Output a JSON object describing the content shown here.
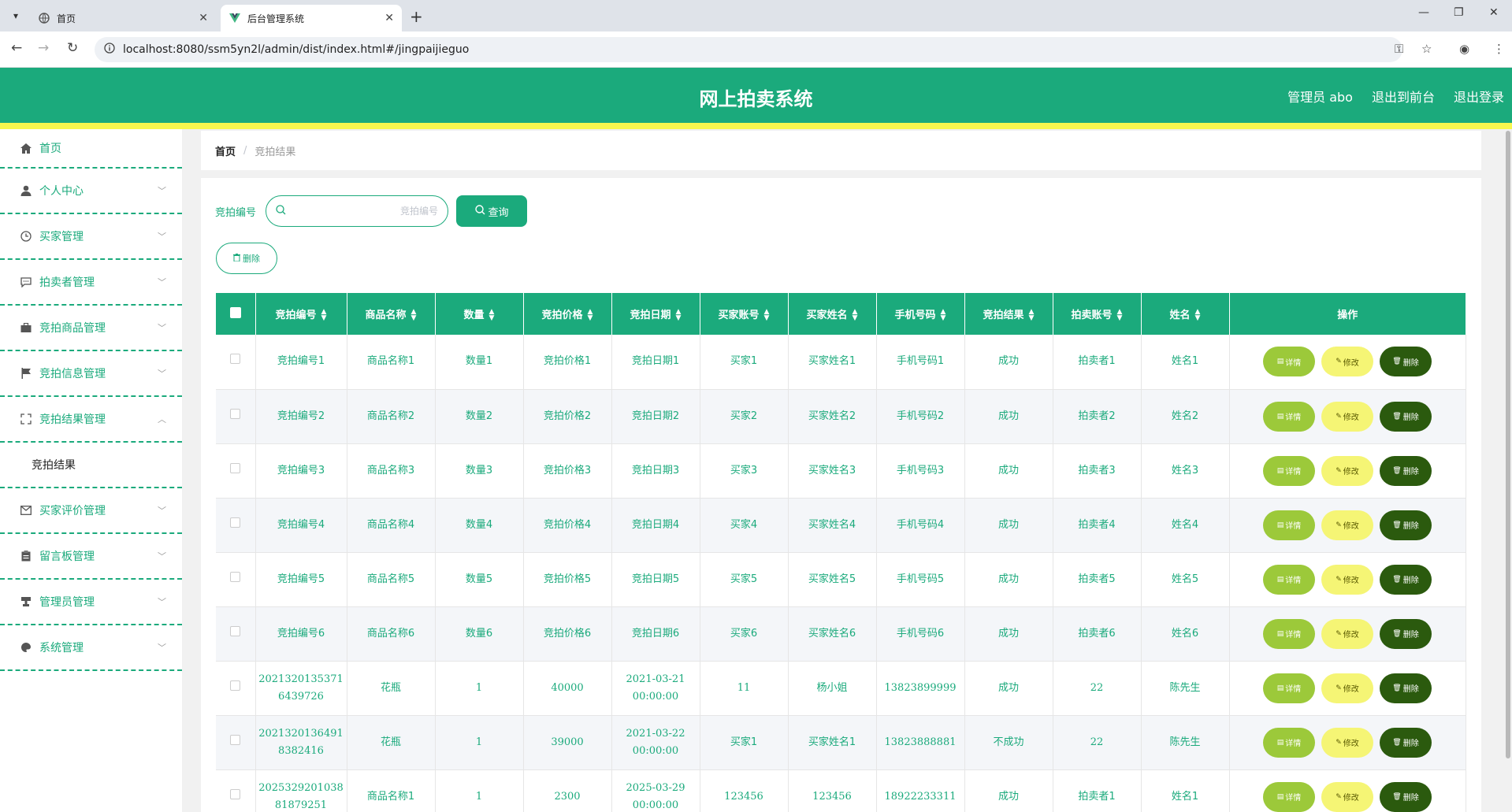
{
  "browser": {
    "tabs": [
      {
        "title": "首页"
      },
      {
        "title": "后台管理系统"
      }
    ],
    "url": "localhost:8080/ssm5yn2l/admin/dist/index.html#/jingpaijieguo"
  },
  "header": {
    "title": "网上拍卖系统",
    "admin": "管理员 abo",
    "to_front": "退出到前台",
    "logout": "退出登录"
  },
  "sidebar": {
    "items": [
      {
        "label": "首页",
        "icon": "home-icon"
      },
      {
        "label": "个人中心",
        "icon": "user-icon"
      },
      {
        "label": "买家管理",
        "icon": "clock-icon"
      },
      {
        "label": "拍卖者管理",
        "icon": "chat-icon"
      },
      {
        "label": "竞拍商品管理",
        "icon": "briefcase-icon"
      },
      {
        "label": "竞拍信息管理",
        "icon": "flag-icon"
      },
      {
        "label": "竞拍结果管理",
        "icon": "fullscreen-icon"
      },
      {
        "label": "竞拍结果",
        "icon": ""
      },
      {
        "label": "买家评价管理",
        "icon": "mail-icon"
      },
      {
        "label": "留言板管理",
        "icon": "clipboard-icon"
      },
      {
        "label": "管理员管理",
        "icon": "stamp-icon"
      },
      {
        "label": "系统管理",
        "icon": "palette-icon"
      }
    ]
  },
  "breadcrumb": {
    "home": "首页",
    "sep": "/",
    "current": "竞拍结果"
  },
  "search": {
    "label": "竞拍编号",
    "placeholder": "竞拍编号",
    "query_btn": "查询",
    "bulk_delete": "删除"
  },
  "table": {
    "columns": [
      "竞拍编号",
      "商品名称",
      "数量",
      "竞拍价格",
      "竞拍日期",
      "买家账号",
      "买家姓名",
      "手机号码",
      "竞拍结果",
      "拍卖账号",
      "姓名",
      "操作"
    ],
    "actions": {
      "detail": "详情",
      "edit": "修改",
      "delete": "删除"
    },
    "rows": [
      [
        "竞拍编号1",
        "商品名称1",
        "数量1",
        "竞拍价格1",
        "竞拍日期1",
        "买家1",
        "买家姓名1",
        "手机号码1",
        "成功",
        "拍卖者1",
        "姓名1"
      ],
      [
        "竞拍编号2",
        "商品名称2",
        "数量2",
        "竞拍价格2",
        "竞拍日期2",
        "买家2",
        "买家姓名2",
        "手机号码2",
        "成功",
        "拍卖者2",
        "姓名2"
      ],
      [
        "竞拍编号3",
        "商品名称3",
        "数量3",
        "竞拍价格3",
        "竞拍日期3",
        "买家3",
        "买家姓名3",
        "手机号码3",
        "成功",
        "拍卖者3",
        "姓名3"
      ],
      [
        "竞拍编号4",
        "商品名称4",
        "数量4",
        "竞拍价格4",
        "竞拍日期4",
        "买家4",
        "买家姓名4",
        "手机号码4",
        "成功",
        "拍卖者4",
        "姓名4"
      ],
      [
        "竞拍编号5",
        "商品名称5",
        "数量5",
        "竞拍价格5",
        "竞拍日期5",
        "买家5",
        "买家姓名5",
        "手机号码5",
        "成功",
        "拍卖者5",
        "姓名5"
      ],
      [
        "竞拍编号6",
        "商品名称6",
        "数量6",
        "竞拍价格6",
        "竞拍日期6",
        "买家6",
        "买家姓名6",
        "手机号码6",
        "成功",
        "拍卖者6",
        "姓名6"
      ],
      [
        "20213201353716439726",
        "花瓶",
        "1",
        "40000",
        "2021-03-21 00:00:00",
        "11",
        "杨小姐",
        "13823899999",
        "成功",
        "22",
        "陈先生"
      ],
      [
        "20213201364918382416",
        "花瓶",
        "1",
        "39000",
        "2021-03-22 00:00:00",
        "买家1",
        "买家姓名1",
        "13823888881",
        "不成功",
        "22",
        "陈先生"
      ],
      [
        "2025329201038 81879251",
        "商品名称1",
        "1",
        "2300",
        "2025-03-29 00:00:00",
        "123456",
        "123456",
        "18922233311",
        "成功",
        "拍卖者1",
        "姓名1"
      ]
    ]
  },
  "colors": {
    "primary": "#1baa7c",
    "accent": "#f7f74e",
    "detail": "#9cc93a",
    "edit": "#f5f575",
    "delete": "#2b5a0e"
  }
}
